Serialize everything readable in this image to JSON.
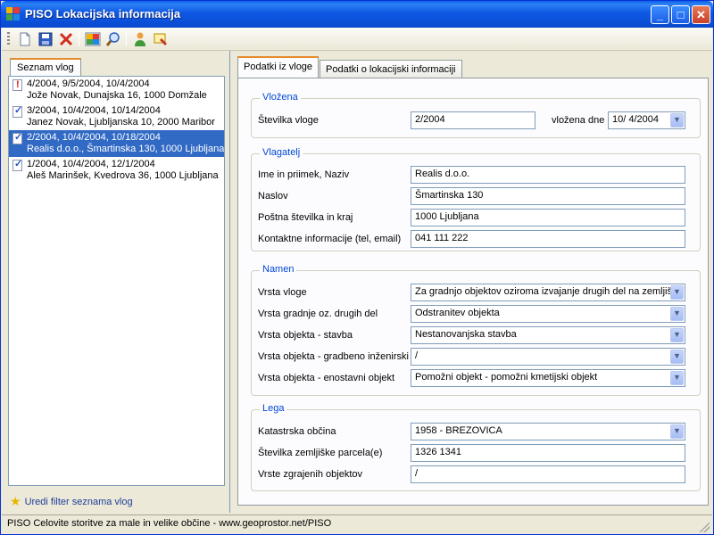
{
  "window": {
    "title": "PISO Lokacijska informacija",
    "minimize_label": "_",
    "maximize_label": "□",
    "close_label": "✕"
  },
  "toolbar": {
    "icons": [
      "new-document-icon",
      "save-icon",
      "delete-icon",
      "map-icon",
      "search-icon",
      "user-icon",
      "stamp-icon"
    ]
  },
  "left_panel": {
    "tab_label": "Seznam vlog",
    "records": [
      {
        "line1": "4/2004, 9/5/2004, 10/4/2004",
        "line2": "Jože Novak, Dunajska 16, 1000 Domžale",
        "icon": "alert"
      },
      {
        "line1": "3/2004, 10/4/2004, 10/14/2004",
        "line2": "Janez Novak, Ljubljanska 10, 2000 Maribor",
        "icon": "check"
      },
      {
        "line1": "2/2004, 10/4/2004, 10/18/2004",
        "line2": "Realis d.o.o., Šmartinska 130, 1000 Ljubljana",
        "icon": "check",
        "selected": true
      },
      {
        "line1": "1/2004, 10/4/2004, 12/1/2004",
        "line2": "Aleš Marinšek, Kvedrova 36, 1000 Ljubljana",
        "icon": "check"
      }
    ],
    "filter_link": "Uredi filter seznama vlog"
  },
  "tabs": {
    "active": "Podatki iz vloge",
    "inactive": "Podatki o lokacijski informaciji"
  },
  "vlozena": {
    "title": "Vložena",
    "stevilka_label": "Številka vloge",
    "stevilka_value": "2/2004",
    "date_label": "vložena dne",
    "date_value": "10/  4/2004"
  },
  "vlagatelj": {
    "title": "Vlagatelj",
    "ime_label": "Ime in priimek, Naziv",
    "ime_value": "Realis d.o.o.",
    "naslov_label": "Naslov",
    "naslov_value": "Šmartinska 130",
    "posta_label": "Poštna številka in kraj",
    "posta_value": "1000 Ljubljana",
    "kontakt_label": "Kontaktne informacije (tel, email)",
    "kontakt_value": "041 111 222"
  },
  "namen": {
    "title": "Namen",
    "vrsta_vloge_label": "Vrsta vloge",
    "vrsta_vloge_value": "Za gradnjo objektov oziroma izvajanje drugih del na zemljišči",
    "vrsta_gradnje_label": "Vrsta gradnje oz. drugih del",
    "vrsta_gradnje_value": "Odstranitev objekta",
    "stavba_label": "Vrsta objekta - stavba",
    "stavba_value": "Nestanovanjska stavba",
    "inzenirski_label": "Vrsta objekta - gradbeno inženirski",
    "inzenirski_value": "/",
    "enostavni_label": "Vrsta objekta - enostavni objekt",
    "enostavni_value": "Pomožni objekt - pomožni kmetijski objekt"
  },
  "lega": {
    "title": "Lega",
    "obcina_label": "Katastrska občina",
    "obcina_value": "1958 - BREZOVICA",
    "parcela_label": "Številka zemljiške parcela(e)",
    "parcela_value": "1326 1341",
    "zgrajeni_label": "Vrste zgrajenih objektov",
    "zgrajeni_value": "/"
  },
  "status": "PISO Celovite storitve za male in velike občine - www.geoprostor.net/PISO",
  "colors": {
    "selection": "#316ac5",
    "group_title": "#0046d5",
    "titlebar": "#0a4fd8"
  }
}
